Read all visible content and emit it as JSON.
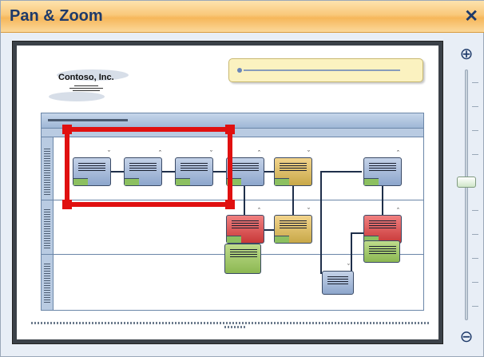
{
  "window": {
    "title": "Pan & Zoom",
    "close_glyph": "✕"
  },
  "zoom": {
    "zoom_in_glyph": "⊕",
    "zoom_out_glyph": "⊖"
  },
  "canvas": {
    "logo_text": "Contoso, Inc."
  },
  "colors": {
    "title_bar": "#f6b75a",
    "selection": "#e01010",
    "shape_blue": "#8da6cc",
    "shape_gold": "#c8a848",
    "shape_red": "#c83838",
    "shape_green": "#8cb852"
  },
  "icons": [
    "close-icon",
    "zoom-in-icon",
    "zoom-out-icon"
  ]
}
